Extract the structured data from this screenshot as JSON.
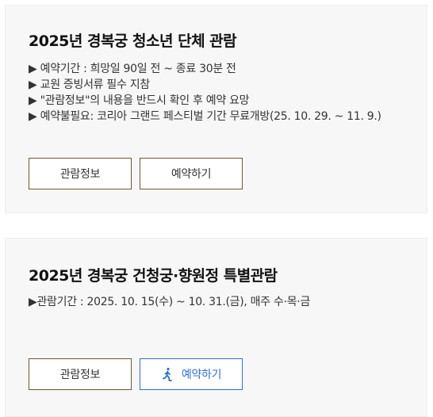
{
  "cards": [
    {
      "title": "2025년 경복궁 청소년 단체 관람",
      "info": [
        "▶ 예약기간 : 희망일 90일 전 ~ 종료 30분 전",
        "▶ 교원 증빙서류 필수 지참",
        "▶ \"관람정보\"의 내용을 반드시 확인 후 예약 요망",
        "▶ 예약불필요: 코리아 그랜드 페스티벌 기간 무료개방(25. 10. 29. ~ 11. 9.)"
      ],
      "buttons": {
        "info_label": "관람정보",
        "reserve_label": "예약하기"
      }
    },
    {
      "title": "2025년 경복궁 건청궁·향원정 특별관람",
      "info": [
        "▶관람기간 : 2025. 10. 15(수) ~ 10. 31.(금), 매주 수·목·금"
      ],
      "buttons": {
        "info_label": "관람정보",
        "reserve_label": "예약하기"
      }
    }
  ],
  "colors": {
    "card_background": "#f7f7f7",
    "button_border": "#6b5a2e",
    "active_accent": "#2f6fd6"
  },
  "icons": {
    "reserve_active": "walking-person-icon"
  }
}
